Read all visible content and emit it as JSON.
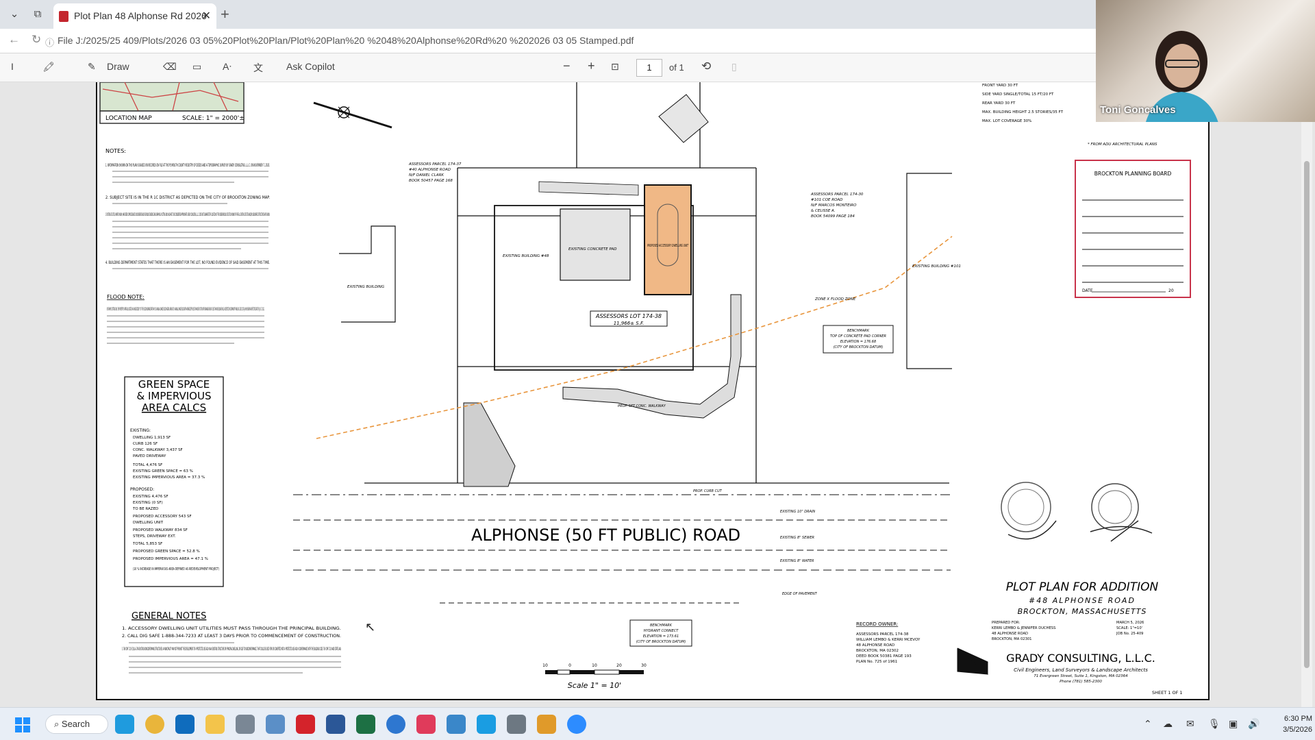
{
  "browser": {
    "tab_title": "Plot Plan  48 Alphonse Rd  2026",
    "url": "File  J:/2025/25 409/Plots/2026 03 05%20Plot%20Plan/Plot%20Plan%20 %2048%20Alphonse%20Rd%20 %202026 03 05 Stamped.pdf"
  },
  "pdf_toolbar": {
    "draw_label": "Draw",
    "ask_copilot_label": "Ask Copilot",
    "page_number": "1",
    "page_total": "of 1",
    "zoom_out": "−",
    "zoom_in": "+"
  },
  "plan": {
    "location_map": {
      "label": "LOCATION MAP",
      "scale": "SCALE: 1\" = 2000'±"
    },
    "notes_heading": "NOTES:",
    "notes": [
      "1.  INFORMATION SHOWN ON THIS PLAN IS BASED ON RECORDS ON FILE AT THE PLYMOUTH COUNTY REGISTRY OF DEEDS AND A TOPOGRAPHIC SURVEY BY GRADY CONSULTING, L.L.C. ON NOVEMBER 7, 2025.",
      "2.  SUBJECT SITE IS IN THE R 1C DISTRICT AS DEPICTED ON THE CITY OF BROCKTON ZONING MAP.",
      "3.  EXISTING UTILITIES, WHERE SHOWN, HAVE BEEN COMPILED BASED ON OBSERVED ABOVE GROUND EVIDENCE AND GRAPHICAL PLOTTING ONLY AND ARE TO BE CONSIDERED APPROXIMATE. GRADY CONSULTING, L.L.C. DOES NOT GUARANTEE THE LOCATION OF THE UNDERGROUND UTILITIES SHOWN OR THAT ALL EXISTING UTILITIES AND/OR SUBSURFACE STRUCTURES ARE SHOWN.",
      "4.  BUILDING DEPARTMENT STATES THAT THERE IS AN EASEMENT FOR THE LOT, NO FOUND EVIDENCE OF SAID EASEMENT AT THIS TIME."
    ],
    "flood_heading": "FLOOD NOTE:",
    "flood_note": "BY GRAPHIC PLOTTING ONLY, THIS PROPERTY IS PARTIALLY LOCATED IN A SHADED ZONE \"X\" OF THE FLOOD INSURANCE RATE MAP. 0.2% ANNUAL CHANCE FLOOD HAZARD, AREAS OF 1% ANNUAL CHANCE FLOOD WITH AVERAGE DEPTH LESS THAN ONE FOOT OR WITH DRAINAGE AREAS OF LESS THAN ONE SQUARE MILE, AS DEPICTED ON COMMUNITY PANEL NO. 25023C 0174J, WHICH BEARS AN EFFECTIVE DATE OF JULY 17, 2012.",
    "green_space": {
      "title_1": "GREEN SPACE",
      "title_2": "& IMPERVIOUS",
      "title_3": "AREA CALCS",
      "existing_heading": "EXISTING:",
      "existing_rows": [
        "DWELLING  1,913 SF",
        "CURB  126 SF",
        "CONC. WALKWAY  3,437 SF",
        "PAVED DRIVEWAY",
        "TOTAL  4,476 SF",
        "EXISTING GREEN SPACE = 63 %",
        "EXISTING IMPERVIOUS AREA = 37.3 %"
      ],
      "proposed_heading": "PROPOSED:",
      "proposed_rows": [
        "EXISTING  4,476 SF",
        "EXISTING  (0 SF)",
        "TO BE RAZED",
        "PROPOSED ACCESSORY  543 SF",
        "DWELLING UNIT",
        "PROPOSED WALKWAY  834 SF",
        "STEPS, DRIVEWAY EXT.",
        "TOTAL  5,853 SF",
        "PROPOSED GREEN SPACE = 52.8 %",
        "PROPOSED IMPERVIOUS AREA = 47.1 %",
        "(10 % INCREASE IN IMPERVIOUS AREA DEFINED AS REDEVELOPMENT PROJECT)"
      ]
    },
    "general_notes_heading": "GENERAL  NOTES",
    "general_notes": [
      "1.  ACCESSORY DWELLING UNIT UTILITIES MUST PASS THROUGH THE PRINCIPAL BUILDING.",
      "2.  CALL DIG SAFE 1-888-344-7233 AT LEAST 3 DAYS PRIOR TO COMMENCEMENT OF CONSTRUCTION.",
      "3.  760 CMR 71.03 (3)(a) & 780-EXISTING NONCONFORMING STRUCTURES. A MUNICIPALITY MAY NOT PROHIBIT THE DEVELOPMENT OF A PROTECTED USE ADU IN AN EXISTING STRUCTURE OR PRINCIPAL DWELLING, OR DUE TO NONCONFORMANCE. THAT COULD BE USED FOR OR CONVERTED INTO A PROTECTED USE ADU IN CONFORMANCE WITH THE BUILDING CODE. 760 CMR 71.00 AND STATE LAW."
    ],
    "road_label": "ALPHONSE  (50 FT PUBLIC)  ROAD",
    "lot_label_1": "ASSESSORS LOT 174-38",
    "lot_label_2": "11,966± S.F.",
    "scale_text": "Scale 1\" = 10'",
    "scale_ticks": [
      "10",
      "0",
      "10",
      "20",
      "30"
    ],
    "benchmark_1": [
      "BENCHMARK",
      "TOP OF CONCRETE PAD CORNER",
      "ELEVATION = 176.68",
      "(CITY OF BROCKTON DATUM)"
    ],
    "benchmark_2": [
      "BENCHMARK",
      "HYDRANT CONNECT",
      "ELEVATION = 173.61",
      "(CITY OF BROCKTON DATUM)"
    ],
    "zoning_table": [
      "FRONT YARD  30 FT",
      "SIDE YARD SINGLE/TOTAL  15 FT/20 FT",
      "REAR YARD  30 FT",
      "MAX. BUILDING HEIGHT  2.5 STORIES/35 FT",
      "MAX. LOT COVERAGE  30%"
    ],
    "architectural_note": "* FROM ADU ARCHITECTURAL PLANS",
    "planning_board": {
      "title": "BROCKTON PLANNING BOARD",
      "date_label": "DATE",
      "year": "20"
    },
    "plan_title": "PLOT PLAN FOR ADDITION",
    "plan_address": "#48  ALPHONSE ROAD",
    "plan_city": "BROCKTON, MASSACHUSETTS",
    "record_owner_heading": "RECORD OWNER:",
    "record_owner": [
      "ASSESSORS PARCEL 174-38",
      "WILLIAM LEMBO & KERRI MCEVOY",
      "48 ALPHONSE ROAD",
      "BROCKTON, MA 02302",
      "DEED BOOK 50381 PAGE 193",
      "PLAN No. 725 of 1961"
    ],
    "prepared_for": [
      "PREPARED FOR:",
      "KERRI LEMBO & JENNIFER DUCHESS",
      "48 ALPHONSE ROAD",
      "BROCKTON, MA 02301"
    ],
    "date_block": [
      "MARCH 5, 2026",
      "SCALE: 1\"=10'",
      "JOB No. 25-409"
    ],
    "firm_name": "GRADY CONSULTING, L.L.C.",
    "firm_tagline": "Civil Engineers, Land Surveyors & Landscape Architects",
    "firm_address": "71 Evergreen Street, Suite 1, Kingston, MA 02364",
    "firm_phone": "Phone (781) 585-2300",
    "sheet_label": "SHEET 1  OF 1",
    "abutter_left": [
      "ASSESSORS PARCEL 174-37",
      "#40 ALPHONSE ROAD",
      "N/F DANIEL CLARK",
      "BOOK 50457 PAGE 168"
    ],
    "abutter_right": [
      "ASSESSORS PARCEL 174-30",
      "#101 COE ROAD",
      "N/F MARCOS MONTEIRO",
      "& CELISSE A.",
      "BOOK 54099 PAGE 184"
    ],
    "building_label": "EXISTING BUILDING #101",
    "existing_building": "EXISTING BUILDING #48",
    "existing_concrete": "EXISTING CONCRETE PAD",
    "existing_dwelling": "EXISTING BUILDING",
    "proposed_adu": "PROPOSED ACCESSORY DWELLING UNIT",
    "flood_zone_label": "ZONE X FLOOD ZONE",
    "front_walk": "PROP. 5FT CONC. WALKWAY",
    "curb_cut": "PROP. CURB CUT",
    "edge_pavement": "EDGE OF PAVEMENT",
    "water": "EXISTING 8\" WATER",
    "sewer": "EXISTING 8\" SEWER",
    "drain": "EXISTING 10\" DRAIN"
  },
  "taskbar": {
    "search_label": "Search",
    "time": "6:30 PM",
    "date": "3/5/2026"
  },
  "webcam": {
    "participant_name": "Toni Goncalves"
  },
  "colors": {
    "adu_fill": "#f0b886",
    "flood_line": "#e8953c",
    "stamp_red": "#c8324a"
  }
}
